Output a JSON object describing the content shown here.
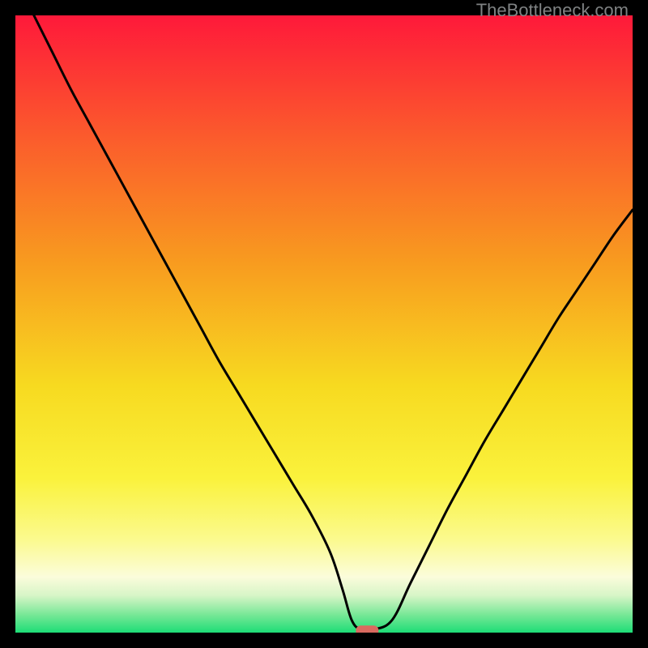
{
  "watermark": "TheBottleneck.com",
  "chart_data": {
    "type": "line",
    "title": "",
    "xlabel": "",
    "ylabel": "",
    "xlim": [
      0,
      100
    ],
    "ylim": [
      0,
      100
    ],
    "grid": false,
    "legend": false,
    "series": [
      {
        "name": "bottleneck-curve",
        "x": [
          3,
          6,
          9,
          12,
          15,
          18,
          21,
          24,
          27,
          30,
          33,
          36,
          39,
          42,
          45,
          48,
          51,
          53,
          54.5,
          56,
          58,
          61,
          64,
          67,
          70,
          73,
          76,
          79,
          82,
          85,
          88,
          91,
          94,
          97,
          100
        ],
        "y": [
          100,
          94,
          88,
          82.5,
          77,
          71.5,
          66,
          60.5,
          55,
          49.5,
          44,
          39,
          34,
          29,
          24,
          19,
          13,
          7,
          2,
          0.5,
          0.5,
          2,
          8,
          14,
          20,
          25.5,
          31,
          36,
          41,
          46,
          51,
          55.5,
          60,
          64.5,
          68.5
        ]
      }
    ],
    "marker": {
      "name": "optimal-point",
      "x": 57,
      "y": 0.3,
      "color": "#d96a5f"
    },
    "background_gradient": {
      "stops": [
        {
          "offset": 0.0,
          "color": "#fe193a"
        },
        {
          "offset": 0.2,
          "color": "#fb5c2c"
        },
        {
          "offset": 0.4,
          "color": "#f89b1f"
        },
        {
          "offset": 0.6,
          "color": "#f7da20"
        },
        {
          "offset": 0.75,
          "color": "#faf23c"
        },
        {
          "offset": 0.85,
          "color": "#fbfa8f"
        },
        {
          "offset": 0.91,
          "color": "#fbfcdb"
        },
        {
          "offset": 0.94,
          "color": "#d7f5c7"
        },
        {
          "offset": 0.97,
          "color": "#7be898"
        },
        {
          "offset": 1.0,
          "color": "#1ddd76"
        }
      ]
    }
  }
}
